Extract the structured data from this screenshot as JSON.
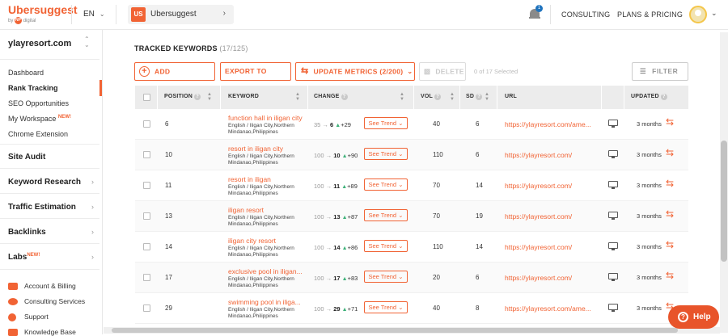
{
  "header": {
    "logo_name": "Ubersuggest",
    "logo_by": "by",
    "logo_np": "NP",
    "logo_digital": "digital",
    "language": "EN",
    "project_badge": "US",
    "project_name": "Ubersuggest",
    "notification_count": "1",
    "nav": [
      "CONSULTING",
      "PLANS & PRICING"
    ]
  },
  "sidebar": {
    "site": "ylayresort.com",
    "items": [
      {
        "label": "Dashboard"
      },
      {
        "label": "Rank Tracking"
      },
      {
        "label": "SEO Opportunities"
      },
      {
        "label": "My Workspace",
        "badge": "NEW!"
      },
      {
        "label": "Chrome Extension"
      }
    ],
    "sections": [
      {
        "label": "Site Audit"
      },
      {
        "label": "Keyword Research"
      },
      {
        "label": "Traffic Estimation"
      },
      {
        "label": "Backlinks"
      },
      {
        "label": "Labs",
        "badge": "NEW!"
      }
    ],
    "footer": [
      {
        "label": "Account & Billing",
        "icon": "billing-icon"
      },
      {
        "label": "Consulting Services",
        "icon": "consulting-icon"
      },
      {
        "label": "Support",
        "icon": "support-icon"
      },
      {
        "label": "Knowledge Base",
        "icon": "knowledge-icon"
      }
    ]
  },
  "toolbar": {
    "title": "TRACKED KEYWORDS",
    "count": "(17/125)",
    "add_keywords": "ADD KEYWORDS",
    "export_csv": "EXPORT TO CSV",
    "update_metrics": "UPDATE METRICS (2/200)",
    "delete": "DELETE",
    "selected": "0 of 17 Selected",
    "filter": "FILTER"
  },
  "table": {
    "headers": {
      "position": "POSITION",
      "keyword": "KEYWORD",
      "change": "CHANGE",
      "vol": "VOL",
      "sd": "SD",
      "url": "URL",
      "updated": "UPDATED"
    },
    "trend_label": "See Trend",
    "rows": [
      {
        "position": "6",
        "keyword": "function hall in iligan city",
        "location": "English / Iligan City,Northern Mindanao,Philippines",
        "from": "35",
        "to": "6",
        "delta": "+29",
        "vol": "40",
        "sd": "6",
        "url": "https://ylayresort.com/ame...",
        "updated": "3 months"
      },
      {
        "position": "10",
        "keyword": "resort in iligan city",
        "location": "English / Iligan City,Northern Mindanao,Philippines",
        "from": "100",
        "to": "10",
        "delta": "+90",
        "vol": "110",
        "sd": "6",
        "url": "https://ylayresort.com/",
        "updated": "3 months"
      },
      {
        "position": "11",
        "keyword": "resort in iligan",
        "location": "English / Iligan City,Northern Mindanao,Philippines",
        "from": "100",
        "to": "11",
        "delta": "+89",
        "vol": "70",
        "sd": "14",
        "url": "https://ylayresort.com/",
        "updated": "3 months"
      },
      {
        "position": "13",
        "keyword": "iligan resort",
        "location": "English / Iligan City,Northern Mindanao,Philippines",
        "from": "100",
        "to": "13",
        "delta": "+87",
        "vol": "70",
        "sd": "19",
        "url": "https://ylayresort.com/",
        "updated": "3 months"
      },
      {
        "position": "14",
        "keyword": "iligan city resort",
        "location": "English / Iligan City,Northern Mindanao,Philippines",
        "from": "100",
        "to": "14",
        "delta": "+86",
        "vol": "110",
        "sd": "14",
        "url": "https://ylayresort.com/",
        "updated": "3 months"
      },
      {
        "position": "17",
        "keyword": "exclusive pool in iligan...",
        "location": "English / Iligan City,Northern Mindanao,Philippines",
        "from": "100",
        "to": "17",
        "delta": "+83",
        "vol": "20",
        "sd": "6",
        "url": "https://ylayresort.com/",
        "updated": "3 months"
      },
      {
        "position": "29",
        "keyword": "swimming pool in iliga...",
        "location": "English / Iligan City,Northern Mindanao,Philippines",
        "from": "100",
        "to": "29",
        "delta": "+71",
        "vol": "40",
        "sd": "8",
        "url": "https://ylayresort.com/ame...",
        "updated": "3 months"
      }
    ]
  },
  "help": {
    "label": "Help"
  },
  "colors": {
    "accent": "#f16334",
    "up": "#3fb17a",
    "header_bg": "#ececec"
  }
}
